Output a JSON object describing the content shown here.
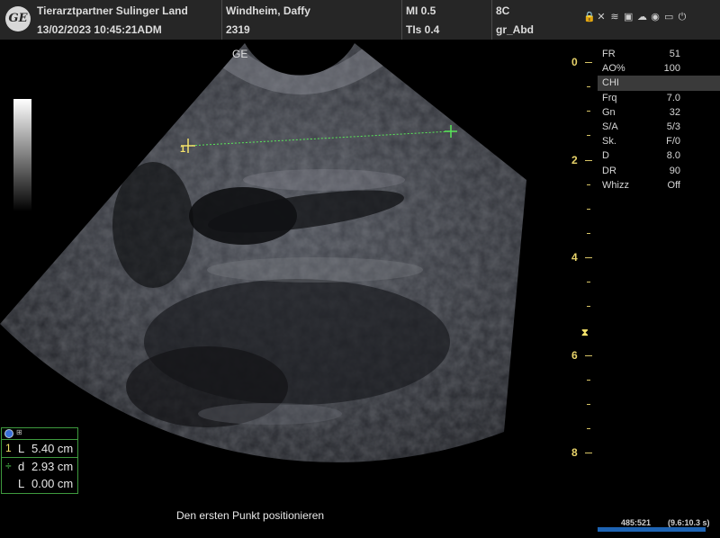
{
  "header": {
    "logo": "GE",
    "facility": "Tierarztpartner Sulinger Land",
    "datetime": "13/02/2023 10:45:21ADM",
    "patient_name": "Windheim, Daffy",
    "patient_id": "2319",
    "mi": "MI 0.5",
    "tis": "TIs 0.4",
    "probe": "8C",
    "preset": "gr_Abd"
  },
  "image": {
    "orientation_label": "GE"
  },
  "params": [
    {
      "label": "FR",
      "value": "51"
    },
    {
      "label": "AO%",
      "value": "100"
    },
    {
      "label": "CHI",
      "value": ""
    },
    {
      "label": "Frq",
      "value": "7.0"
    },
    {
      "label": "Gn",
      "value": "32"
    },
    {
      "label": "S/A",
      "value": "5/3"
    },
    {
      "label": "Sk.",
      "value": "F/0"
    },
    {
      "label": "D",
      "value": "8.0"
    },
    {
      "label": "DR",
      "value": "90"
    },
    {
      "label": "Whizz",
      "value": "Off"
    }
  ],
  "depth_labels": [
    "0",
    "2",
    "4",
    "6",
    "8"
  ],
  "measurements": [
    {
      "marker": "1",
      "type": "L",
      "value": "5.40 cm"
    },
    {
      "marker": "÷",
      "type": "d",
      "value": "2.93 cm"
    },
    {
      "marker": "",
      "type": "L",
      "value": "0.00 cm"
    }
  ],
  "caliper_markers": {
    "start": "1",
    "end": "+"
  },
  "prompt": "Den ersten Punkt positionieren",
  "cine": {
    "frames": "485:521",
    "time": "(9.6:10.3 s)",
    "progress": 0.93
  },
  "colors": {
    "accent_yellow": "#e8d36a",
    "measure_green": "#3e9a3e",
    "caliper_green": "#59e859",
    "progress_blue": "#1e64b4"
  }
}
